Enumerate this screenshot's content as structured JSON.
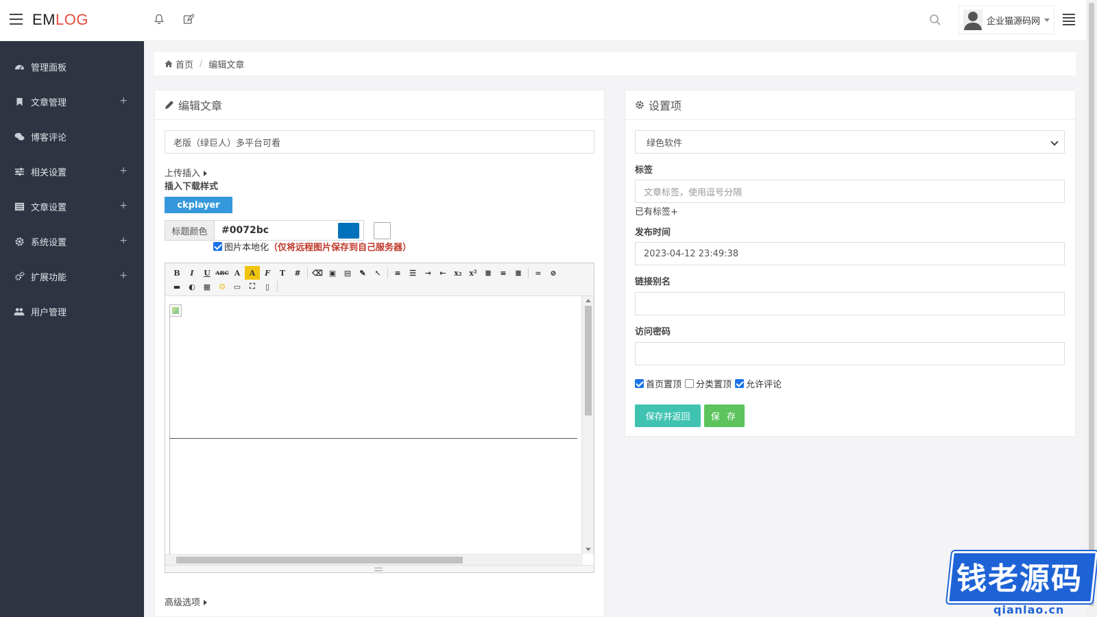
{
  "app": {
    "logo_part1": "EM",
    "logo_part2": "LOG",
    "brand_color": "#e74c3c"
  },
  "header": {
    "user_name": "企业猫源码网",
    "icons": [
      "menu-icon",
      "bell-icon",
      "edit-icon",
      "search-icon",
      "list-icon"
    ]
  },
  "sidebar": {
    "items": [
      {
        "label": "管理面板",
        "icon": "dashboard-icon",
        "expandable": false
      },
      {
        "label": "文章管理",
        "icon": "bookmark-icon",
        "expandable": true
      },
      {
        "label": "博客评论",
        "icon": "comments-icon",
        "expandable": false
      },
      {
        "label": "相关设置",
        "icon": "sliders-icon",
        "expandable": true
      },
      {
        "label": "文章设置",
        "icon": "list-alt-icon",
        "expandable": true
      },
      {
        "label": "系统设置",
        "icon": "gear-icon",
        "expandable": true
      },
      {
        "label": "扩展功能",
        "icon": "cogs-icon",
        "expandable": true
      },
      {
        "label": "用户管理",
        "icon": "users-icon",
        "expandable": false
      }
    ],
    "plus": "+"
  },
  "breadcrumb": {
    "home": "首页",
    "separator": "/",
    "current": "编辑文章"
  },
  "editor_card": {
    "title": "编辑文章",
    "post_title_value": "老版（绿巨人）多平台可看",
    "upload_insert": "上传插入",
    "insert_download_style": "插入下载样式",
    "ckplayer_button": "ckplayer",
    "title_color_label": "标题颜色",
    "title_color_value": "#0072bc",
    "title_color": "#0072bc",
    "localize_images_label": "图片本地化",
    "localize_images_checked": true,
    "localize_images_note": "（仅将远程图片保存到自己服务器）",
    "advanced_options": "高级选项"
  },
  "settings_card": {
    "title": "设置项",
    "category_selected": "绿色软件",
    "tags_label": "标签",
    "tags_placeholder": "文章标签，使用逗号分隔",
    "existing_tags": "已有标签+",
    "publish_time_label": "发布时间",
    "publish_time_value": "2023-04-12 23:49:38",
    "slug_label": "链接别名",
    "slug_value": "",
    "password_label": "访问密码",
    "password_value": "",
    "options": [
      {
        "label": "首页置顶",
        "checked": true
      },
      {
        "label": "分类置顶",
        "checked": false
      },
      {
        "label": "允许评论",
        "checked": true
      }
    ],
    "save_return_button": "保存并返回",
    "save_button": "保 存",
    "teal": "#3fc3b0",
    "green": "#5cc35d"
  },
  "watermark": {
    "text": "钱老源码",
    "url": "qianlao.cn"
  }
}
